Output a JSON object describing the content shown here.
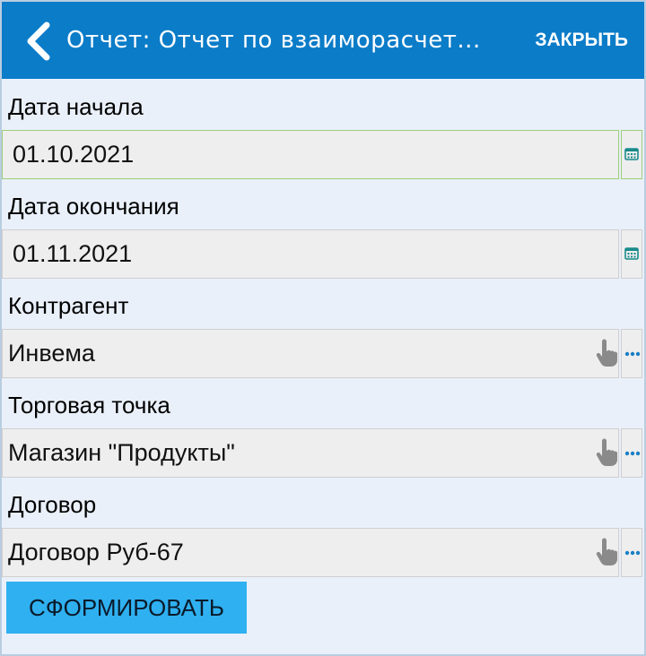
{
  "header": {
    "title": "Отчет: Отчет по взаиморасчет...",
    "close_label": "ЗАКРЫТЬ",
    "background_color": "#0b7cc8"
  },
  "form": {
    "start_date": {
      "label": "Дата начала",
      "value": "01.10.2021",
      "icon": "calendar-icon"
    },
    "end_date": {
      "label": "Дата окончания",
      "value": "01.11.2021",
      "icon": "calendar-icon"
    },
    "counterparty": {
      "label": "Контрагент",
      "value": "Инвема",
      "icons": [
        "hand-pointer-icon",
        "more-dots-icon"
      ]
    },
    "store": {
      "label": "Торговая точка",
      "value": "Магазин \"Продукты\"",
      "icons": [
        "hand-pointer-icon",
        "more-dots-icon"
      ]
    },
    "contract": {
      "label": "Договор",
      "value": "Договор Руб-67",
      "icons": [
        "hand-pointer-icon",
        "more-dots-icon"
      ]
    }
  },
  "actions": {
    "submit_label": "СФОРМИРОВАТЬ",
    "submit_color": "#2fb0f0"
  }
}
